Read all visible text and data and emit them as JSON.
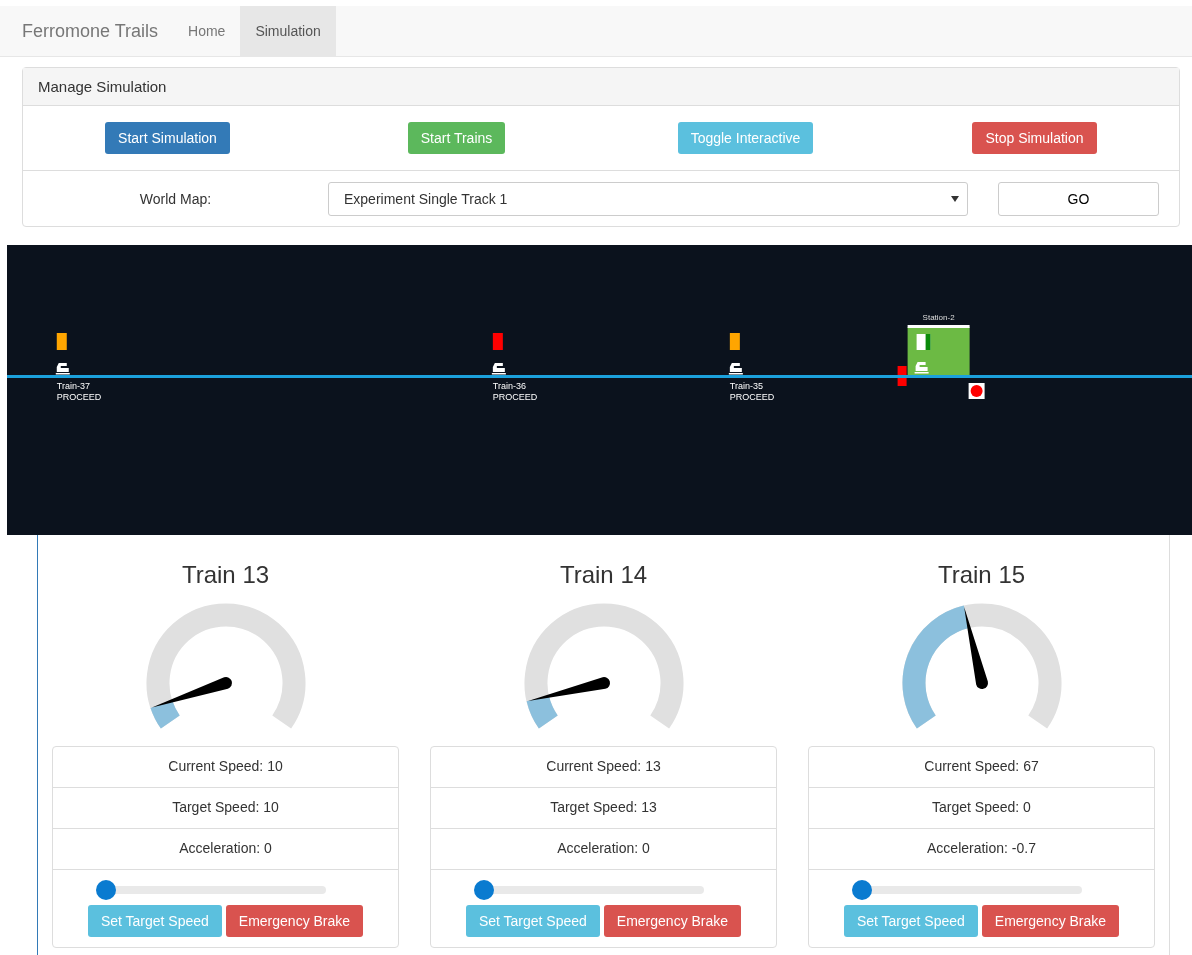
{
  "navbar": {
    "brand": "Ferromone Trails",
    "tabs": [
      {
        "label": "Home",
        "selected": false
      },
      {
        "label": "Simulation",
        "selected": true
      }
    ]
  },
  "manage": {
    "title": "Manage Simulation",
    "buttons": [
      {
        "label": "Start Simulation",
        "kind": "primary"
      },
      {
        "label": "Start Trains",
        "kind": "success"
      },
      {
        "label": "Toggle Interactive",
        "kind": "info"
      },
      {
        "label": "Stop Simulation",
        "kind": "danger"
      }
    ],
    "world_map_label": "World Map:",
    "world_map_value": "Experiment Single Track 1",
    "go": "GO"
  },
  "map": {
    "signals": [
      {
        "color": "#ffa500"
      },
      {
        "color": "#ff0000"
      },
      {
        "color": "#ffa500"
      }
    ],
    "trains": [
      {
        "name": "Train-37",
        "status": "PROCEED"
      },
      {
        "name": "Train-36",
        "status": "PROCEED"
      },
      {
        "name": "Train-35",
        "status": "PROCEED"
      }
    ],
    "station": {
      "name": "Station-2"
    }
  },
  "trains": [
    {
      "title": "Train 13",
      "current": "Current Speed: 10",
      "target": "Target Speed: 10",
      "accel": "Acceleration: 0",
      "level": 0,
      "set": "Set Target Speed",
      "brake": "Emergency Brake"
    },
    {
      "title": "Train 14",
      "current": "Current Speed: 13",
      "target": "Target Speed: 13",
      "accel": "Acceleration: 0",
      "level": 0,
      "set": "Set Target Speed",
      "brake": "Emergency Brake"
    },
    {
      "title": "Train 15",
      "current": "Current Speed: 67",
      "target": "Target Speed: 0",
      "accel": "Acceleration: -0.7",
      "level": 0,
      "set": "Set Target Speed",
      "brake": "Emergency Brake"
    }
  ]
}
